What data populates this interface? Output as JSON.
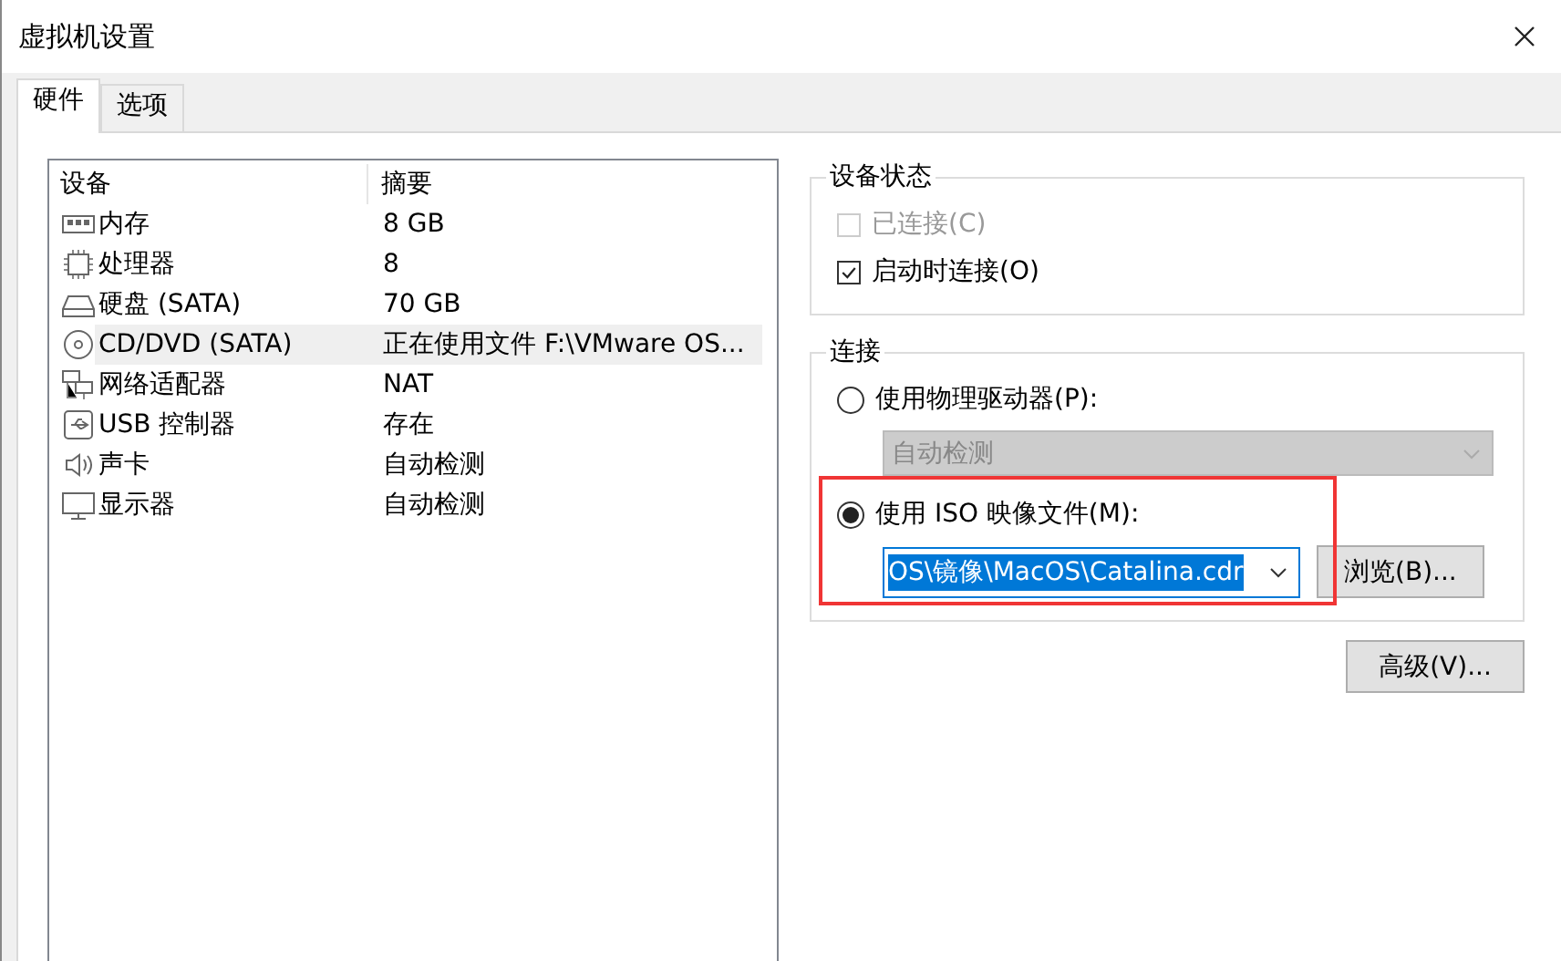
{
  "window": {
    "title": "虚拟机设置"
  },
  "tabs": [
    {
      "label": "硬件",
      "selected": true
    },
    {
      "label": "选项",
      "selected": false
    }
  ],
  "devices": {
    "columns": [
      "设备",
      "摘要"
    ],
    "rows": [
      {
        "kind": "memory",
        "name": "内存",
        "summary": "8 GB",
        "selected": false
      },
      {
        "kind": "cpu",
        "name": "处理器",
        "summary": "8",
        "selected": false
      },
      {
        "kind": "disk",
        "name": "硬盘 (SATA)",
        "summary": "70 GB",
        "selected": false
      },
      {
        "kind": "cd",
        "name": "CD/DVD (SATA)",
        "summary": "正在使用文件 F:\\VMware OS...",
        "selected": true
      },
      {
        "kind": "network",
        "name": "网络适配器",
        "summary": "NAT",
        "selected": false
      },
      {
        "kind": "usb",
        "name": "USB 控制器",
        "summary": "存在",
        "selected": false
      },
      {
        "kind": "sound",
        "name": "声卡",
        "summary": "自动检测",
        "selected": false
      },
      {
        "kind": "display",
        "name": "显示器",
        "summary": "自动检测",
        "selected": false
      }
    ]
  },
  "device_status": {
    "title": "设备状态",
    "options": [
      {
        "label": "已连接(C)",
        "checked": false,
        "disabled": true
      },
      {
        "label": "启动时连接(O)",
        "checked": true,
        "disabled": false
      }
    ]
  },
  "connection": {
    "title": "连接",
    "options": [
      {
        "kind": "drive",
        "label": "使用物理驱动器(P):",
        "selected": false,
        "highlighted": false,
        "field": {
          "value": "自动检测",
          "disabled": true,
          "text_selected": false
        }
      },
      {
        "kind": "iso",
        "label": "使用 ISO 映像文件(M):",
        "selected": true,
        "highlighted": true,
        "field": {
          "value": "OS\\镜像\\MacOS\\Catalina.cdr",
          "disabled": false,
          "text_selected": true
        },
        "browse_button": "浏览(B)..."
      }
    ]
  },
  "advanced_button": "高级(V)..."
}
